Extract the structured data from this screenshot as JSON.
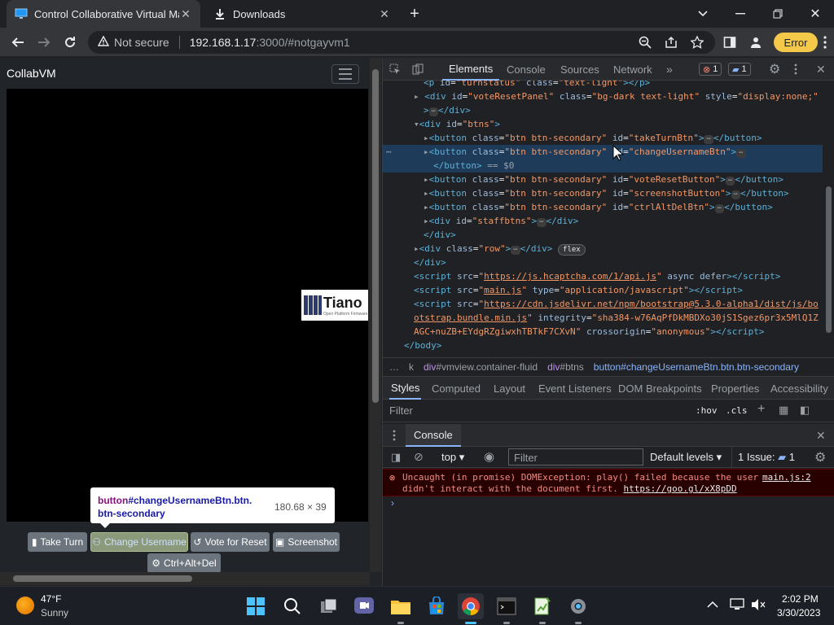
{
  "browser": {
    "tabs": [
      {
        "title": "Control Collaborative Virtual Mac",
        "active": true
      },
      {
        "title": "Downloads",
        "active": false
      }
    ],
    "address": {
      "warning": "Not secure",
      "host": "192.168.1.17",
      "path": ":3000/#notgayvm1"
    },
    "error_pill": "Error"
  },
  "page": {
    "brand": "CollabVM",
    "logo_text": "Tiano",
    "logo_subtext": "Open Platform Firmware",
    "buttons": {
      "take_turn": "Take Turn",
      "change_username": "Change Username",
      "vote_reset": "Vote for Reset",
      "screenshot": "Screenshot",
      "ctrl_alt_del": "Ctrl+Alt+Del"
    },
    "tooltip": {
      "tag": "button",
      "selector": "#changeUsernameBtn.btn.",
      "selector_cont": "btn-secondary",
      "dims": "180.68 × 39"
    }
  },
  "devtools": {
    "tabs": [
      "Elements",
      "Console",
      "Sources",
      "Network"
    ],
    "error_count": "1",
    "msg_count": "1",
    "breadcrumbs": {
      "k": "k",
      "vmview_tag": "div",
      "vmview_rest": "#vmview.container-fluid",
      "btns_tag": "div",
      "btns_rest": "#btns",
      "btn_tag": "button",
      "btn_rest": "#changeUsernameBtn.btn.btn-secondary"
    },
    "style_tabs": [
      "Styles",
      "Computed",
      "Layout",
      "Event Listeners",
      "DOM Breakpoints",
      "Properties",
      "Accessibility"
    ],
    "filter_placeholder": "Filter",
    "hov": ":hov",
    "cls": ".cls",
    "drawer_title": "Console",
    "console_toolbar": {
      "context": "top",
      "filter_placeholder": "Filter",
      "levels": "Default levels",
      "issues_label": "1 Issue:",
      "issues_count": "1"
    },
    "error": {
      "line1": "Uncaught (in promise) DOMException: play() failed because the user",
      "line2": "didn't interact with the document first.",
      "link": "https://goo.gl/xX8pDD",
      "source": "main.js:2"
    },
    "dom": {
      "l0_id": "turnstatus",
      "l0_class": "text-light",
      "l1_id": "voteResetPanel",
      "l1_class": "bg-dark text-light",
      "l1_style": "display:none;",
      "l3_id": "btns",
      "l4_class": "btn btn-secondary",
      "l4_id": "takeTurnBtn",
      "l5_class": "btn btn-secondary",
      "l5_id": "changeUsernameBtn",
      "l6_eq": "== $0",
      "l7_id": "voteResetButton",
      "l8_id": "screenshotButton",
      "l9_id": "ctrlAltDelBtn",
      "l10_id": "staffbtns",
      "l12_class": "row",
      "l12_badge": "flex",
      "l14_src": "https://js.hcaptcha.com/1/api.js",
      "l14_attr": "async defer",
      "l15_src": "main.js",
      "l15_type": "application/javascript",
      "l16_src1": "https://cdn.jsdelivr.net/npm/bootstrap@5.3.0-alpha1/dist/js/bo",
      "l17_src2": "otstrap.bundle.min.js",
      "l17_integrity1": "sha384-w76AqPfDkMBDXo30jS1Sgez6pr3x5MlQ1Z",
      "l18_integrity2": "AGC+nuZB+EYdgRZgiwxhTBTkF7CXvN",
      "l18_crossorigin": "anonymous"
    }
  },
  "taskbar": {
    "weather_temp": "47°F",
    "weather_desc": "Sunny",
    "time": "2:02 PM",
    "date": "3/30/2023"
  }
}
